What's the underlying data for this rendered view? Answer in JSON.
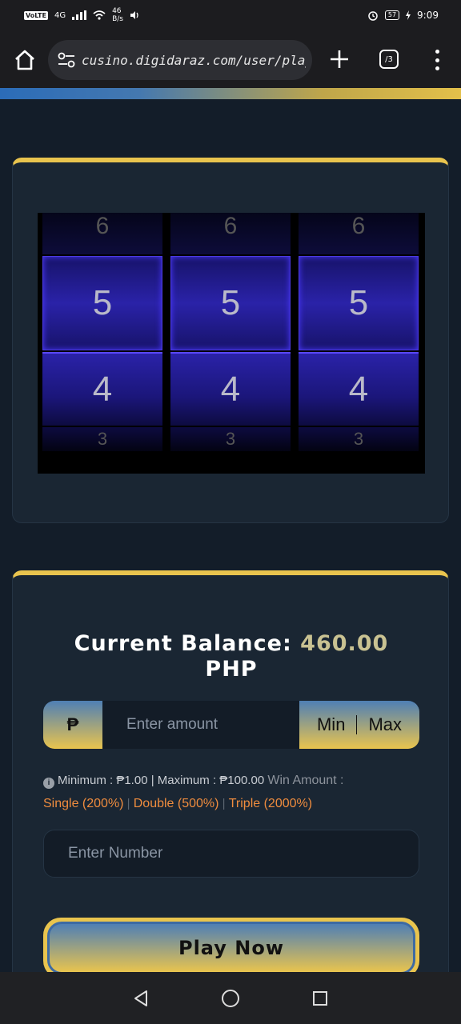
{
  "status_bar": {
    "left_tag": "VoLTE",
    "network": "4G",
    "speed_value": "46",
    "speed_unit": "B/s",
    "battery": "57",
    "time": "9:09"
  },
  "browser": {
    "url": "cusino.digidaraz.com/user/play/",
    "tab_count": "/3"
  },
  "slot": {
    "reels": [
      {
        "top": "6",
        "middle": "5",
        "lower": "4",
        "bottom": "3"
      },
      {
        "top": "6",
        "middle": "5",
        "lower": "4",
        "bottom": "3"
      },
      {
        "top": "6",
        "middle": "5",
        "lower": "4",
        "bottom": "3"
      }
    ]
  },
  "balance": {
    "label": "Current Balance:",
    "amount": "460.00",
    "currency": "PHP"
  },
  "bet": {
    "currency_symbol": "₱",
    "amount_placeholder": "Enter amount",
    "min_label": "Min",
    "max_label": "Max",
    "limits": "Minimum : ₱1.00 | Maximum : ₱100.00",
    "win_label": "Win Amount :",
    "single": "Single (200%)",
    "double": "Double (500%)",
    "triple": "Triple (2000%)",
    "number_placeholder": "Enter Number",
    "play_label": "Play Now"
  },
  "colors": {
    "accent_gold": "#e9c44e",
    "accent_blue": "#4f7fb5",
    "background": "#131d29",
    "card": "#1a2633",
    "odds_orange": "#ef8c3e",
    "balance_amount": "#c9c292"
  },
  "icons": [
    "home-icon",
    "site-settings-icon",
    "plus-icon",
    "tabs-icon",
    "more-vert-icon",
    "info-icon",
    "back-icon",
    "home-circle-icon",
    "recents-icon"
  ]
}
